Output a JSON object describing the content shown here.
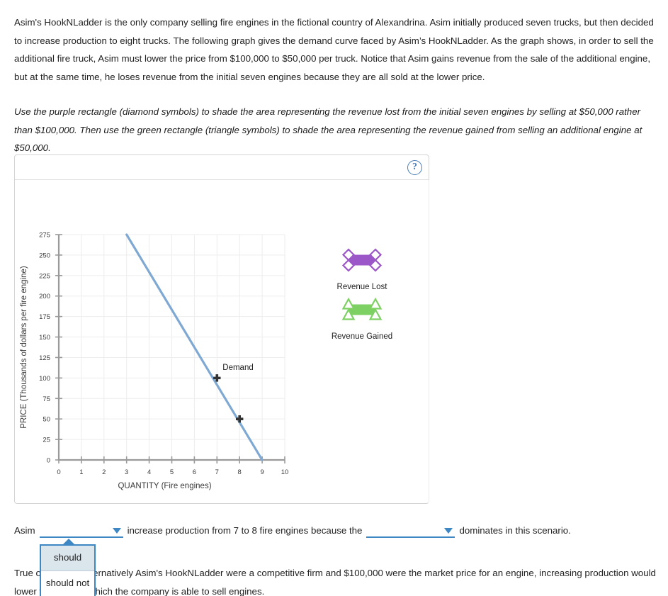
{
  "intro": {
    "paragraph": "Asim's HookNLadder is the only company selling fire engines in the fictional country of Alexandrina. Asim initially produced seven trucks, but then decided to increase production to eight trucks. The following graph gives the demand curve faced by Asim’s HookNLadder. As the graph shows, in order to sell the additional fire truck, Asim must lower the price from $100,000 to $50,000 per truck. Notice that Asim gains revenue from the sale of the additional engine, but at the same time, he loses revenue from the initial seven engines because they are all sold at the lower price."
  },
  "instructions": {
    "paragraph": "Use the purple rectangle (diamond symbols) to shade the area representing the revenue lost from the initial seven engines by selling at $50,000 rather than $100,000. Then use the green rectangle (triangle symbols) to shade the area representing the revenue gained from selling an additional engine at $50,000."
  },
  "graph_panel": {
    "help_icon": "help-question-icon",
    "help_label": "?"
  },
  "chart_data": {
    "type": "line",
    "title": "",
    "xlabel": "QUANTITY (Fire engines)",
    "ylabel": "PRICE (Thousands of dollars per fire engine)",
    "xlim": [
      0,
      10
    ],
    "ylim": [
      0,
      275
    ],
    "xticks": [
      0,
      1,
      2,
      3,
      4,
      5,
      6,
      7,
      8,
      9,
      10
    ],
    "yticks": [
      0,
      25,
      50,
      75,
      100,
      125,
      150,
      175,
      200,
      225,
      250,
      275
    ],
    "grid": true,
    "series": [
      {
        "name": "Demand",
        "type": "line",
        "color": "#7FA9D3",
        "x": [
          3,
          9
        ],
        "y": [
          275,
          0
        ]
      }
    ],
    "markers": [
      {
        "name": "point-7-100",
        "x": 7,
        "y": 100,
        "symbol": "plus",
        "color": "#333333"
      },
      {
        "name": "point-8-50",
        "x": 8,
        "y": 50,
        "symbol": "plus",
        "color": "#333333"
      }
    ],
    "annotations": [
      {
        "name": "demand-label",
        "text": "Demand",
        "x": 7.25,
        "y": 110
      }
    ],
    "legend": {
      "position": "right",
      "entries": [
        {
          "label": "Revenue Lost",
          "color": "#9B56C8",
          "symbol": "diamond"
        },
        {
          "label": "Revenue Gained",
          "color": "#7DD163",
          "symbol": "triangle"
        }
      ]
    }
  },
  "question1": {
    "prefix": "Asim",
    "dropdown_value": "",
    "middle": "increase production from 7 to 8 fire engines because the",
    "dropdown2_value": "",
    "suffix": "dominates in this scenario.",
    "options": [
      "should",
      "should not"
    ],
    "selected_option": "should"
  },
  "question2": {
    "text": "True or False: If alternatively Asim's HookNLadder were a competitive firm and $100,000 were the market price for an engine, increasing production would lower the price at which the company is able to sell engines."
  }
}
